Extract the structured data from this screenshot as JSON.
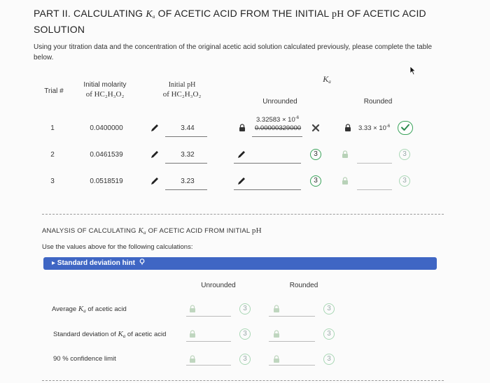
{
  "header": {
    "title_part1": "PART II. CALCULATING",
    "ka_symbol": "K",
    "ka_sub": "a",
    "title_part2": "OF ACETIC ACID FROM THE INITIAL",
    "ph": "pH",
    "title_part3": "OF ACETIC ACID",
    "title_line2": "SOLUTION",
    "intro": "Using your titration data and the concentration of the original acetic acid solution calculated previously, please complete the table below."
  },
  "table": {
    "col_trial": "Trial #",
    "col_molarity_line1": "Initial molarity",
    "col_molarity_line2": "of HC₂H₃O₂",
    "col_ph_line1": "Initial pH",
    "col_ph_line2": "of HC₂H₃O₂",
    "col_ka": "K",
    "col_ka_sub": "a",
    "col_unrounded": "Unrounded",
    "col_rounded": "Rounded",
    "rows": [
      {
        "trial": "1",
        "molarity": "0.0400000",
        "ph": "3.44",
        "unrounded_top": "3.32583 × 10",
        "unrounded_top_exp": "-6",
        "unrounded_struck": "0.00000329000",
        "rounded": "3.33 × 10",
        "rounded_exp": "-6"
      },
      {
        "trial": "2",
        "molarity": "0.0461539",
        "ph": "3.32",
        "badge": "3",
        "badge2": "3"
      },
      {
        "trial": "3",
        "molarity": "0.0518519",
        "ph": "3.23",
        "badge": "3",
        "badge2": "3"
      }
    ]
  },
  "analysis": {
    "title_part1": "ANALYSIS OF CALCULATING",
    "title_part2": "OF ACETIC ACID FROM INITIAL",
    "ph": "pH",
    "instruction": "Use the values above for the following calculations:",
    "hint_label": "▸ Standard deviation hint",
    "col_unrounded": "Unrounded",
    "col_rounded": "Rounded",
    "rows": [
      {
        "label_pre": "Average",
        "label_post": "of acetic acid",
        "b1": "3",
        "b2": "3"
      },
      {
        "label_pre": "Standard deviation of",
        "label_post": "of acetic acid",
        "b1": "3",
        "b2": "3"
      },
      {
        "label_pre": "90 % confidence limit",
        "label_post": "",
        "b1": "3",
        "b2": "3"
      }
    ]
  },
  "colors": {
    "accent": "#3f66c4",
    "correct": "#3aa35a",
    "wrong": "#444444"
  }
}
